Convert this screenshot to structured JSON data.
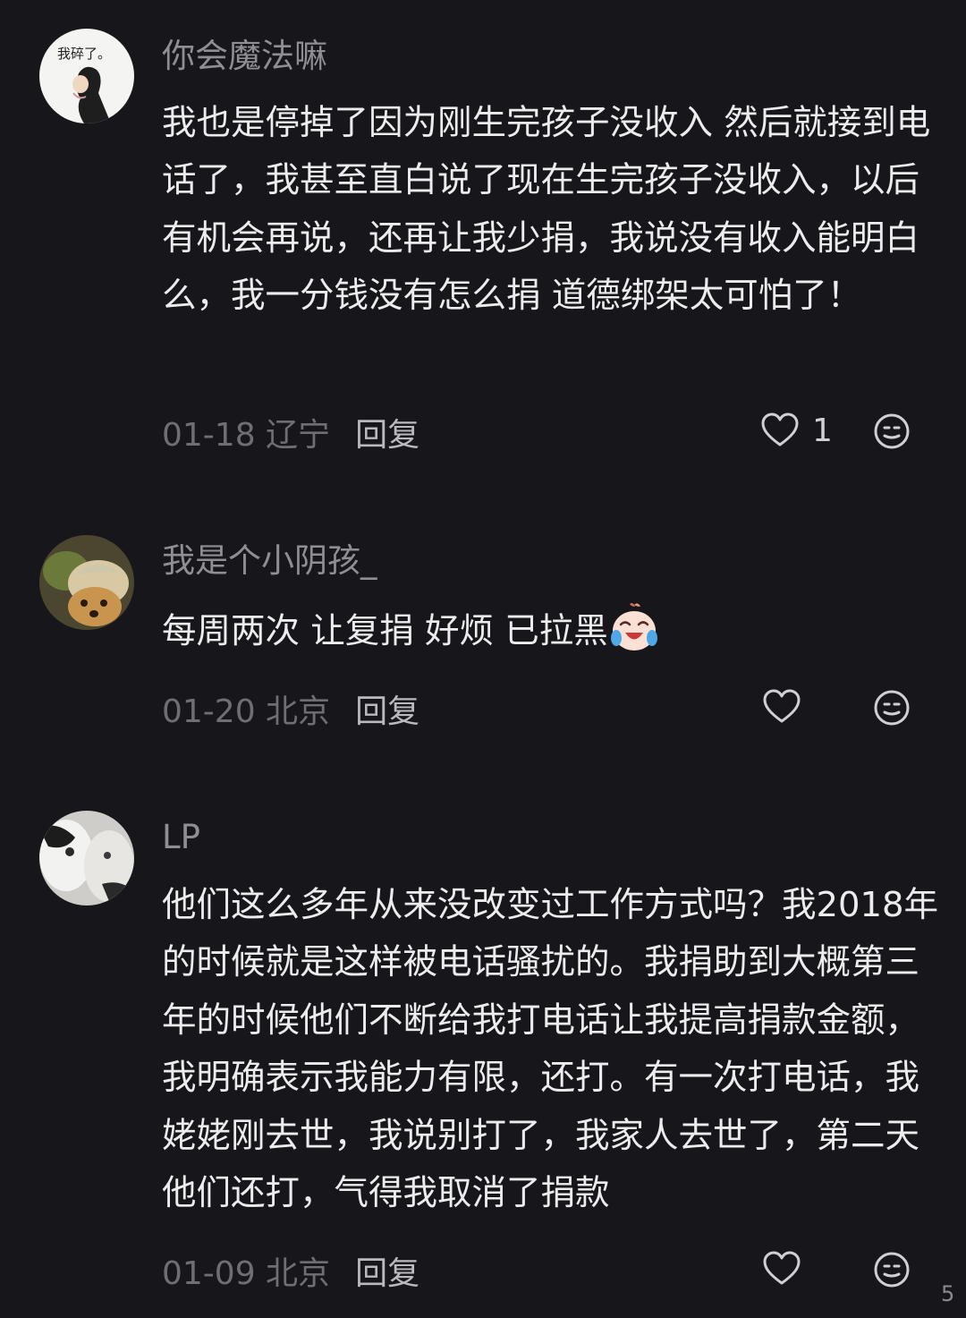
{
  "comments": [
    {
      "username": "你会魔法嘛",
      "avatar_text": "我碎了。",
      "text": "我也是停掉了因为刚生完孩子没收入 然后就接到电话了，我甚至直白说了现在生完孩子没收入，以后有机会再说，还再让我少捐，我说没有收入能明白么，我一分钱没有怎么捐 道德绑架太可怕了！",
      "date_location": "01-18 辽宁",
      "reply_label": "回复",
      "likes": "1",
      "like_icon": "heart-outline",
      "emoji_icon": "smiley-outline"
    },
    {
      "username": "我是个小阴孩_",
      "text": "每周两次 让复捐 好烦 已拉黑",
      "inline_emoji": "crying-laughing-emoji",
      "date_location": "01-20 北京",
      "reply_label": "回复",
      "likes": "",
      "like_icon": "heart-outline",
      "emoji_icon": "smiley-outline"
    },
    {
      "username": "LP",
      "text": "他们这么多年从来没改变过工作方式吗？我2018年的时候就是这样被电话骚扰的。我捐助到大概第三年的时候他们不断给我打电话让我提高捐款金额，我明确表示我能力有限，还打。有一次打电话，我姥姥刚去世，我说别打了，我家人去世了，第二天他们还打，气得我取消了捐款",
      "date_location": "01-09 北京",
      "reply_label": "回复",
      "likes": "",
      "like_icon": "heart-outline",
      "emoji_icon": "smiley-outline"
    }
  ],
  "watermark": "5"
}
